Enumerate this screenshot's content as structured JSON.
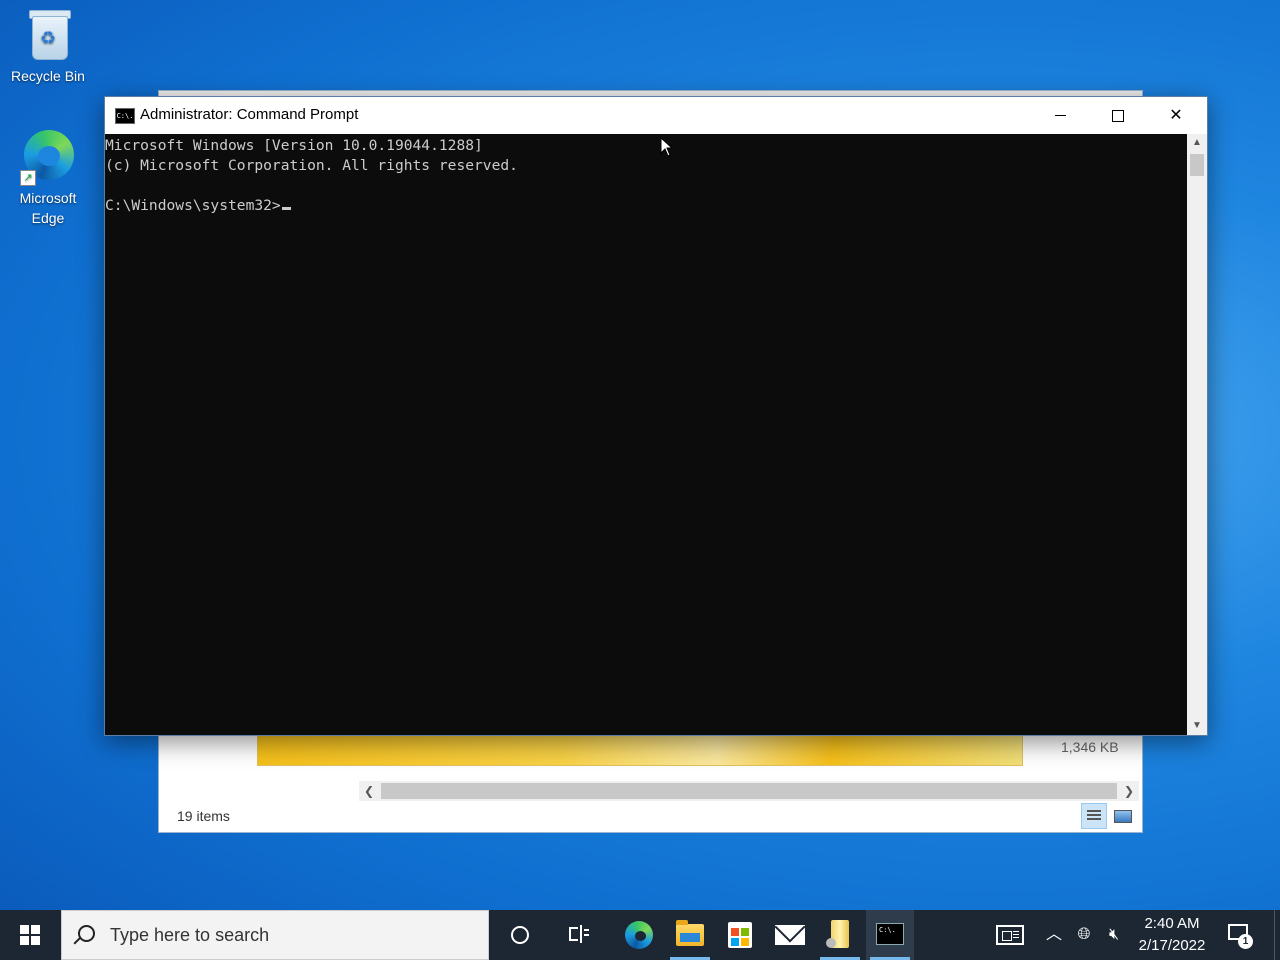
{
  "desktop": {
    "icons": [
      {
        "label": "Recycle Bin",
        "icon": "recycle-bin-icon"
      },
      {
        "label": "Microsoft Edge",
        "icon": "edge-icon"
      }
    ]
  },
  "explorer": {
    "file_size": "1,346 KB",
    "status": "19 items"
  },
  "cmd": {
    "title": "Administrator: Command Prompt",
    "icon_text": "C:\\.",
    "lines": [
      "Microsoft Windows [Version 10.0.19044.1288]",
      "(c) Microsoft Corporation. All rights reserved.",
      "",
      "C:\\Windows\\system32>"
    ]
  },
  "taskbar": {
    "search_placeholder": "Type here to search",
    "apps": [
      "cortana-icon",
      "task-view-icon",
      "edge-icon",
      "file-explorer-icon",
      "store-icon",
      "mail-icon",
      "scroll-app-icon",
      "command-prompt-icon"
    ],
    "clock": {
      "time": "2:40 AM",
      "date": "2/17/2022"
    },
    "notifications_count": "1"
  }
}
